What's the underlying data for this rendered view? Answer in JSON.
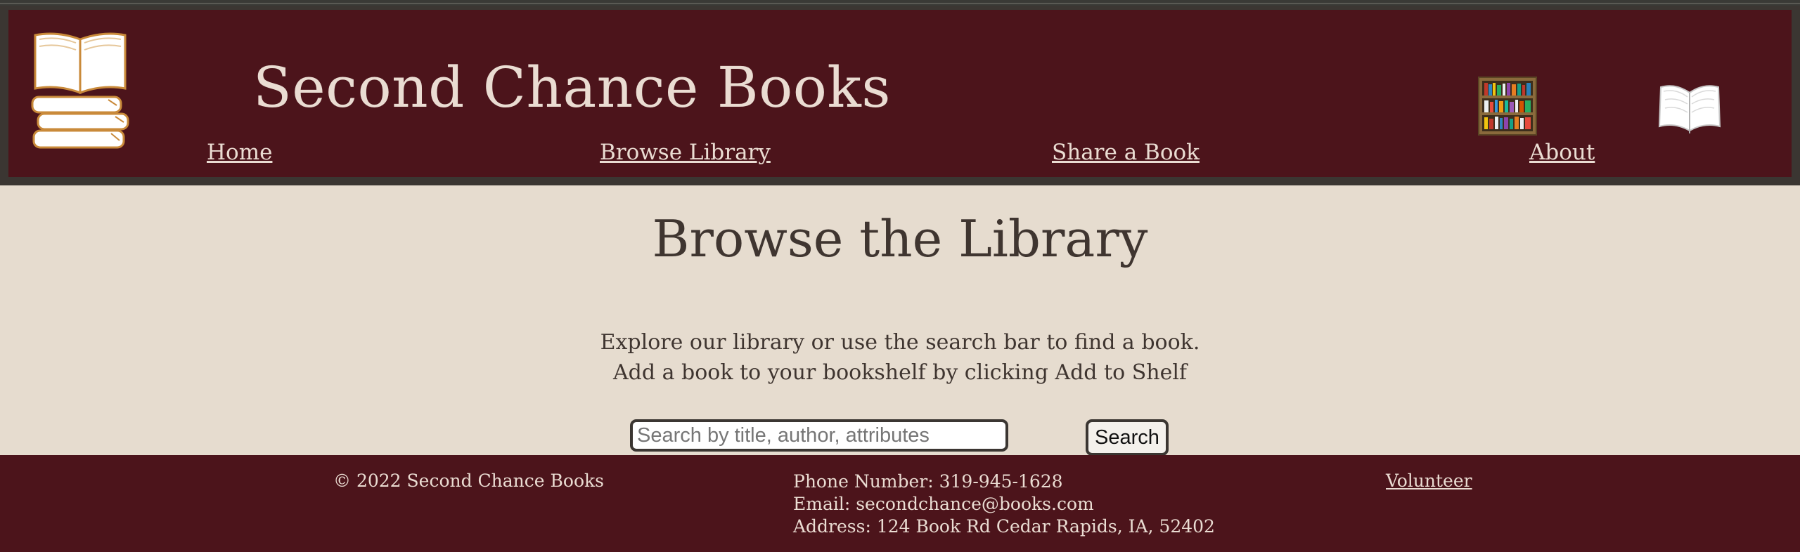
{
  "header": {
    "site_title": "Second Chance Books",
    "nav": [
      {
        "label": "Home"
      },
      {
        "label": "Browse Library"
      },
      {
        "label": "Share a Book"
      },
      {
        "label": "About"
      }
    ],
    "icons": [
      "books-stack-logo-icon",
      "bookshelf-icon",
      "open-book-icon"
    ]
  },
  "main": {
    "heading": "Browse the Library",
    "intro_lines": [
      "Explore our library or use the search bar to find a book.",
      "Add a book to your bookshelf by clicking Add to Shelf"
    ],
    "search": {
      "placeholder": "Search by title, author, attributes",
      "value": "",
      "button_label": "Search"
    }
  },
  "footer": {
    "copyright": "© 2022 Second Chance Books",
    "phone": "Phone Number: 319-945-1628",
    "email": "Email: secondchance@books.com",
    "address": "Address: 124 Book Rd Cedar Rapids, IA, 52402",
    "volunteer_label": "Volunteer"
  },
  "colors": {
    "header_bg": "#4c141b",
    "header_frame": "#3b3632",
    "page_bg": "#e6dccf",
    "header_text": "#eadcd2",
    "body_text": "#3f3530"
  }
}
